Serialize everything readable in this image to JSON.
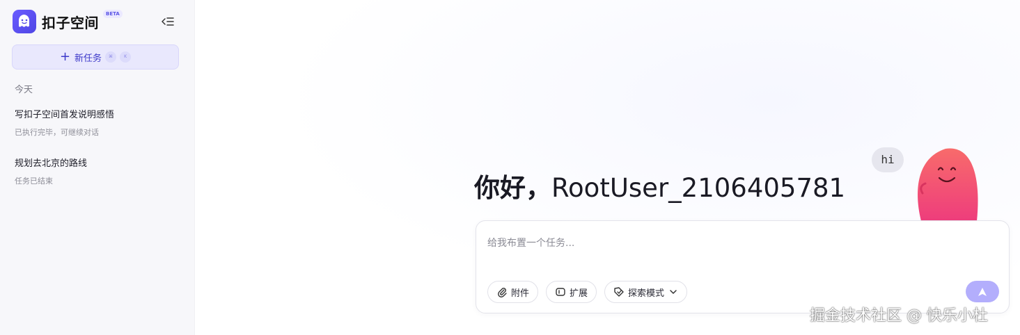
{
  "sidebar": {
    "brand": "扣子空间",
    "beta": "BETA",
    "new_task_label": "新任务",
    "shortcut_keys": [
      "⌘",
      "K"
    ],
    "section_today": "今天",
    "history": [
      {
        "title": "写扣子空间首发说明感悟",
        "status": "已执行完毕，可继续对话"
      },
      {
        "title": "规划去北京的路线",
        "status": "任务已结束"
      }
    ]
  },
  "main": {
    "greeting_hello": "你好，",
    "greeting_user": "RootUser_2106405781",
    "bubble_text": "hi",
    "input_placeholder": "给我布置一个任务...",
    "tools": {
      "attach": "附件",
      "extend": "扩展",
      "explore": "探索模式"
    }
  },
  "watermark": "掘金技术社区 @ 快乐小杜",
  "colors": {
    "accent": "#4f46e5",
    "new_task_bg": "#e9e8fd",
    "send_button": "#b3aefc",
    "mascot": "#f2566e"
  },
  "icons": {
    "logo": "ghost-logo-icon",
    "collapse": "collapse-sidebar-icon",
    "attach": "paperclip-icon",
    "extend": "plugin-icon",
    "explore": "tag-icon",
    "dropdown": "chevron-down-icon",
    "send": "send-arrow-icon"
  }
}
